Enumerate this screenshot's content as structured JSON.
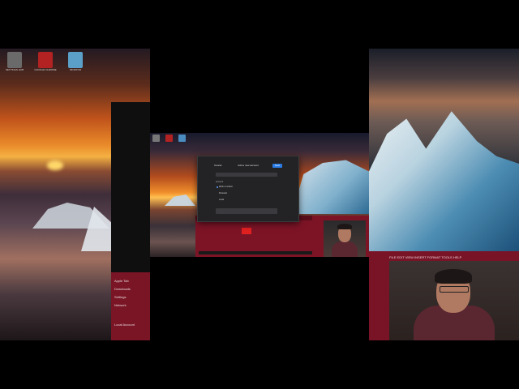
{
  "left_desktop": {
    "icons": [
      {
        "label": "SETTINGS HUB",
        "icon": "document-icon",
        "color": "#6a6a6a"
      },
      {
        "label": "GOOGLE CHROME",
        "icon": "app-icon",
        "color": "#b22222"
      },
      {
        "label": "MONITOR",
        "icon": "chart-icon",
        "color": "#5aa0c8"
      }
    ]
  },
  "left_window": {
    "items": [
      "Apple Tab",
      "Downloads",
      "Settings",
      "Network",
      "Local Account"
    ]
  },
  "dialog": {
    "title": "Add a new account",
    "cancel_label": "Cancel",
    "next_label": "Next",
    "section_label": "Account",
    "options": [
      "Work or school",
      "Personal",
      "Local"
    ]
  },
  "right_panel": {
    "menu_text": "FILE   EDIT   VIEW   INSERT   FORMAT   TOOLS   HELP"
  },
  "colors": {
    "accent_red": "#7d1426",
    "dialog_bg": "#232325",
    "primary_button": "#2a7be4"
  }
}
